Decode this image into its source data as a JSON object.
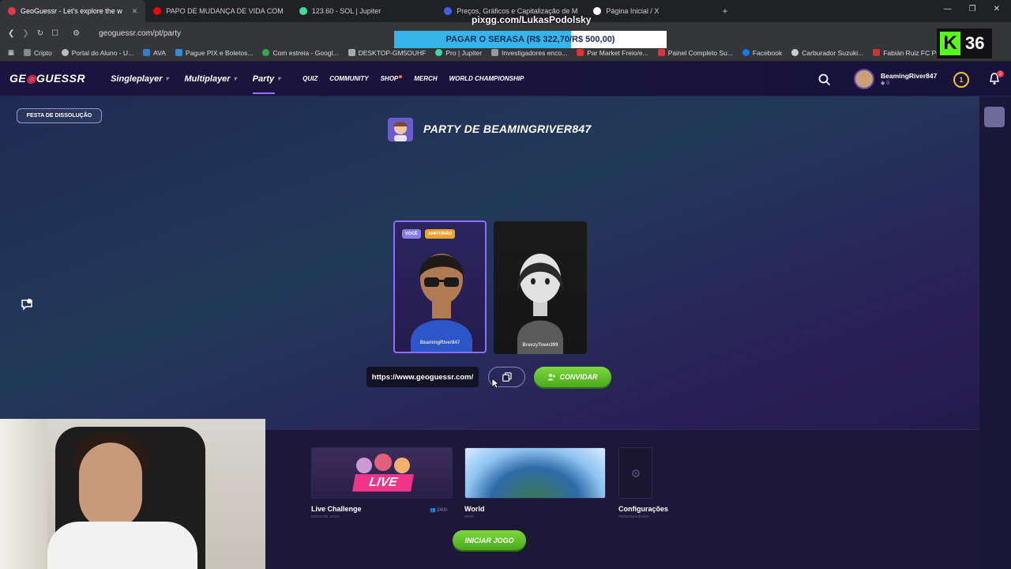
{
  "browser": {
    "tabs": [
      {
        "title": "GeoGuessr - Let's explore the w",
        "active": true,
        "color": "#e8394c"
      },
      {
        "title": "PAPO DE MUDANÇA DE VIDA COM",
        "active": false,
        "color": "#ff0000"
      },
      {
        "title": "123.60 - SOL | Jupiter",
        "active": false,
        "color": "#3ddc97"
      },
      {
        "title": "Preços, Gráficos e Capitalização de M",
        "active": false,
        "color": "#3861fb"
      },
      {
        "title": "Página Inicial / X",
        "active": false,
        "color": "#ffffff"
      }
    ],
    "url": "geoguessr.com/pt/party",
    "bookmarks": [
      "Cripto",
      "Portal do Aluno - U...",
      "AVA",
      "Pague PIX e Boletos...",
      "Com estreia - Googl...",
      "DESKTOP-GM5OUHF",
      "Pro | Jupiter",
      "Investigadores enco...",
      "Par Market Freio/e...",
      "Painel Completo Su...",
      "Facebook",
      "Carburador Suzuki...",
      "Fabián Ruiz FC Pro L..."
    ]
  },
  "overlay": {
    "username": "pixgg.com/LukasPodolsky",
    "pay_text": "PAGAR O SERASA (R$ 322,70/R$ 500,00)",
    "pay_progress": 0.65,
    "kick_count": "36"
  },
  "header": {
    "logo": "GEOGUESSR",
    "nav_main": [
      "Singleplayer",
      "Multiplayer",
      "Party"
    ],
    "nav_secondary": [
      "QUIZ",
      "COMMUNITY",
      "SHOP",
      "MERCH",
      "WORLD CHAMPIONSHIP"
    ],
    "profile_name": "BeamingRiver847",
    "profile_level": "0",
    "coin_value": "1",
    "notifications": "2"
  },
  "party": {
    "disband_label": "FESTA DE DISSOLUÇÃO",
    "title": "PARTY DE BEAMINGRIVER847",
    "members": [
      {
        "name": "BeamingRiver847",
        "tag_you": "VOCÊ",
        "tag_host": "ANFITRIÃO"
      },
      {
        "name": "BreezyTown399"
      }
    ],
    "invite_link": "https://www.geoguessr.com/",
    "invite_label": "CONVIDAR"
  },
  "modes": [
    {
      "label": "Live Challenge",
      "sub": "MODO DE JOGO",
      "count": "2400",
      "badge": "LIVE"
    },
    {
      "label": "World",
      "sub": "MAPA"
    },
    {
      "label": "Configurações",
      "sub": "PERSONALIZADO"
    }
  ],
  "start_label": "INICIAR JOGO",
  "colors": {
    "accent": "#9b6bff",
    "green": "#5fbf2a",
    "live_pink": "#f0348a"
  }
}
